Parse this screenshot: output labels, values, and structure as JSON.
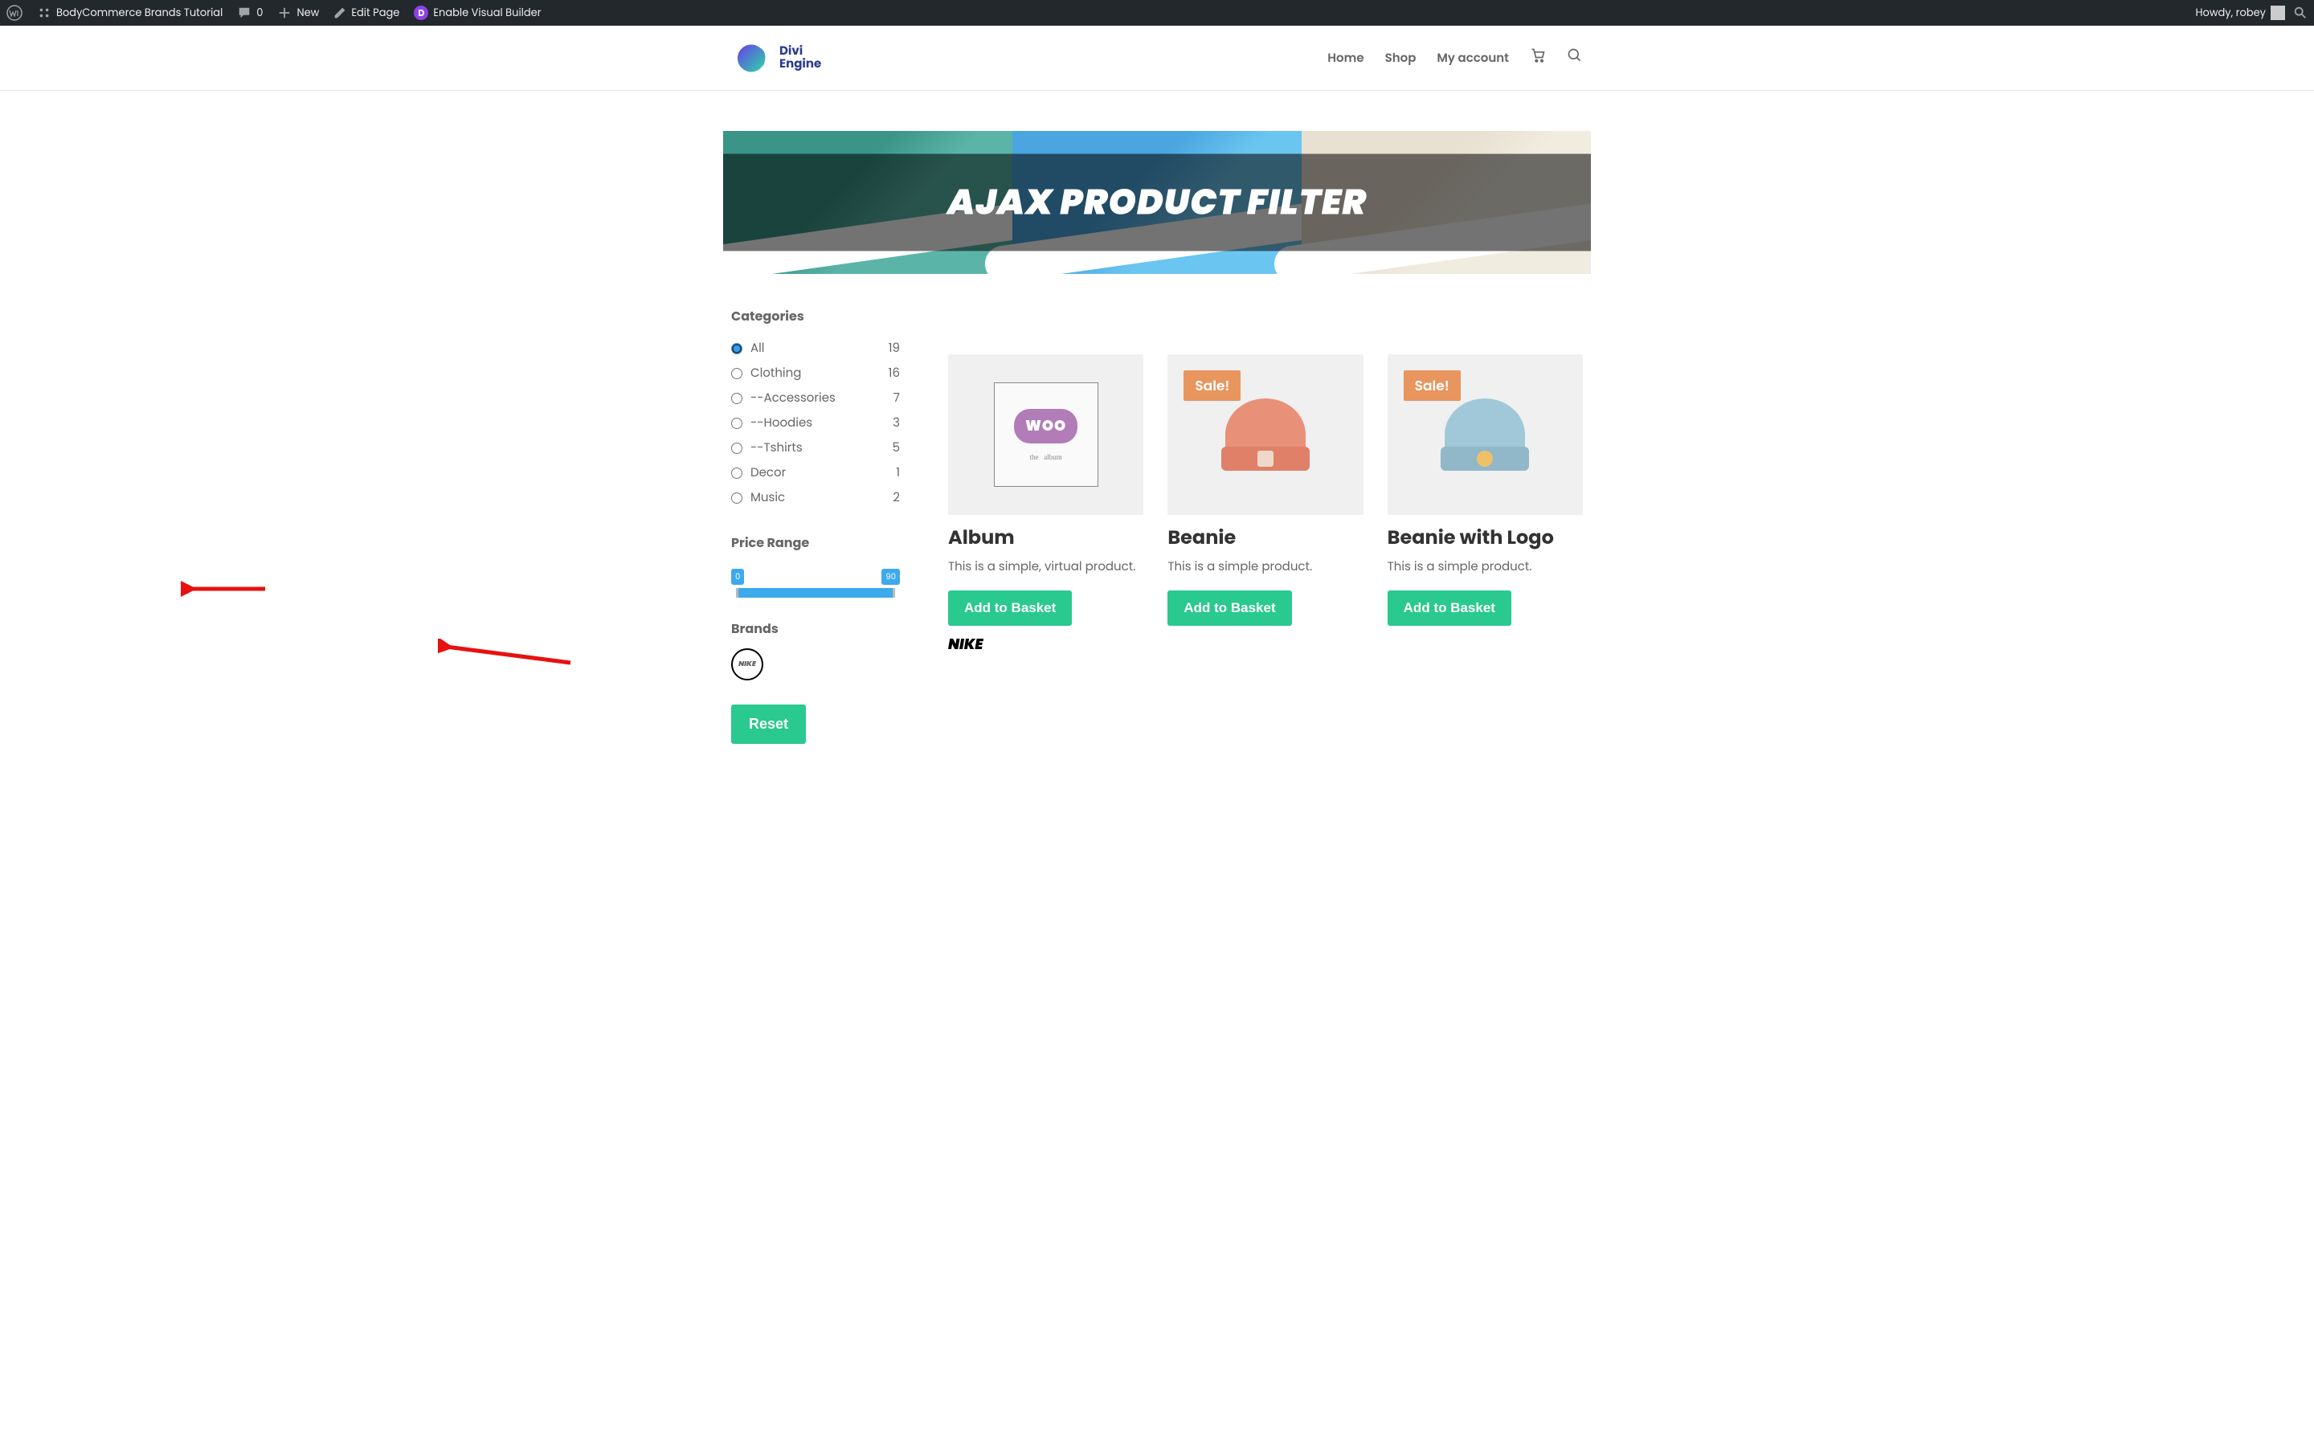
{
  "adminbar": {
    "site_title": "BodyCommerce Brands Tutorial",
    "comments": "0",
    "new": "New",
    "edit_page": "Edit Page",
    "visual_builder": "Enable Visual Builder",
    "howdy": "Howdy, robey"
  },
  "logo": {
    "line1": "Divi",
    "line2": "Engine"
  },
  "nav": {
    "home": "Home",
    "shop": "Shop",
    "account": "My account"
  },
  "hero": {
    "title": "AJAX PRODUCT FILTER"
  },
  "filters": {
    "categories_heading": "Categories",
    "categories": [
      {
        "label": "All",
        "count": "19",
        "checked": true
      },
      {
        "label": "Clothing",
        "count": "16",
        "checked": false
      },
      {
        "label": "--Accessories",
        "count": "7",
        "checked": false
      },
      {
        "label": "--Hoodies",
        "count": "3",
        "checked": false
      },
      {
        "label": "--Tshirts",
        "count": "5",
        "checked": false
      },
      {
        "label": "Decor",
        "count": "1",
        "checked": false
      },
      {
        "label": "Music",
        "count": "2",
        "checked": false
      }
    ],
    "price_heading": "Price Range",
    "price_min": "0",
    "price_max": "90",
    "brands_heading": "Brands",
    "brand_label": "NIKE",
    "reset": "Reset"
  },
  "products": [
    {
      "title": "Album",
      "desc": "This is a simple, virtual product.",
      "btn": "Add to Basket",
      "brand": "NIKE",
      "sale": false,
      "img": "album"
    },
    {
      "title": "Beanie",
      "desc": "This is a simple product.",
      "btn": "Add to Basket",
      "sale": true,
      "sale_label": "Sale!",
      "img": "beanie-orange"
    },
    {
      "title": "Beanie with Logo",
      "desc": "This is a simple product.",
      "btn": "Add to Basket",
      "sale": true,
      "sale_label": "Sale!",
      "img": "beanie-blue"
    }
  ]
}
